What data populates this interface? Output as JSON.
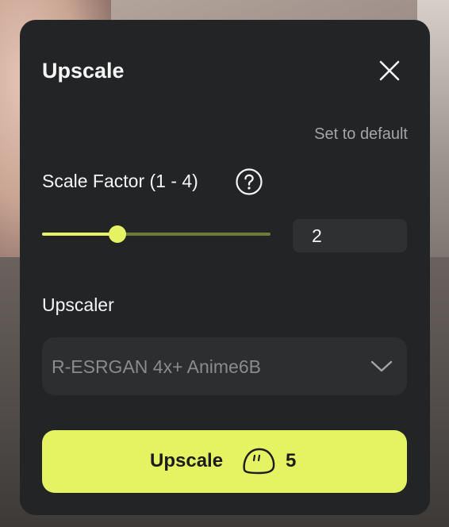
{
  "dialog": {
    "title": "Upscale",
    "set_default_label": "Set to default",
    "scale_factor": {
      "label": "Scale Factor (1 - 4)",
      "min": 1,
      "max": 4,
      "value": "2",
      "slider_fraction": 0.33
    },
    "upscaler": {
      "label": "Upscaler",
      "selected": "R-ESRGAN 4x+ Anime6B"
    },
    "action": {
      "label": "Upscale",
      "credits": "5"
    }
  },
  "colors": {
    "panel_bg": "#232425",
    "accent": "#e5f262",
    "text": "#f5f5f5",
    "muted_text": "#a4a5a7"
  },
  "icons": [
    "close-icon",
    "help-icon",
    "chevron-down-icon",
    "credit-icon"
  ]
}
